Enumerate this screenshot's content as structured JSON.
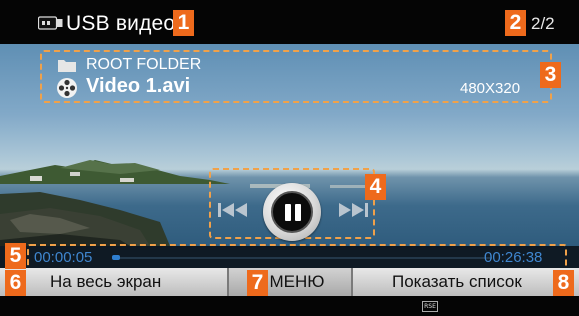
{
  "header": {
    "title": "USB видео",
    "page_count": "2/2",
    "icon": "usb-icon"
  },
  "file_info": {
    "folder_name": "ROOT FOLDER",
    "file_name": "Video 1.avi",
    "resolution": "480X320",
    "folder_icon": "folder-icon",
    "file_icon": "film-reel-icon"
  },
  "playback": {
    "elapsed": "00:00:05",
    "total": "00:26:38",
    "progress_fraction": 0.02,
    "state_icon": "pause-icon",
    "rewind_icon": "rewind-icon",
    "fast_forward_icon": "fast-forward-icon"
  },
  "menu": {
    "fullscreen_label": "На весь экран",
    "menu_label": "МЕНЮ",
    "show_list_label": "Показать список"
  },
  "bottom": {
    "badge": "RSE"
  },
  "callouts": [
    "1",
    "2",
    "3",
    "4",
    "5",
    "6",
    "7",
    "8"
  ],
  "colors": {
    "callout": "#ee6a1c",
    "dashed_outline": "#f0a14a",
    "time_text": "#3f86cf",
    "progress_fill": "#2f7fd0",
    "header_bg": "#050505"
  }
}
